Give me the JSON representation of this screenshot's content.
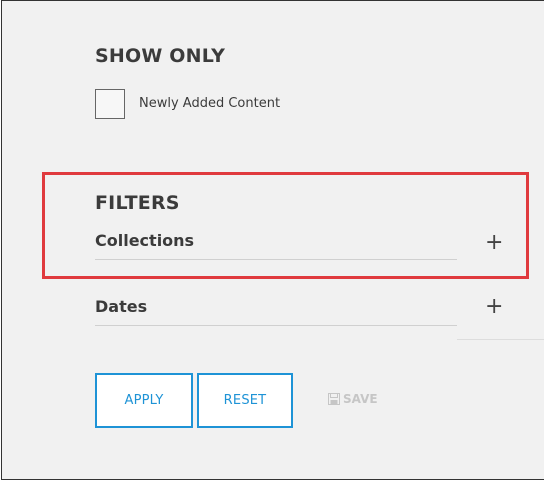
{
  "show_only": {
    "title": "SHOW ONLY",
    "checkbox_label": "Newly Added Content",
    "checked": false
  },
  "filters": {
    "title": "FILTERS",
    "items": [
      {
        "label": "Collections",
        "icon": "plus-icon"
      },
      {
        "label": "Dates",
        "icon": "plus-icon"
      }
    ]
  },
  "actions": {
    "apply": "APPLY",
    "reset": "RESET",
    "save": "SAVE",
    "save_icon": "floppy-disk-icon"
  },
  "colors": {
    "accent": "#1e93d6",
    "highlight": "#e03a3e",
    "text": "#3b3b3b",
    "disabled": "#c6c6c6"
  }
}
